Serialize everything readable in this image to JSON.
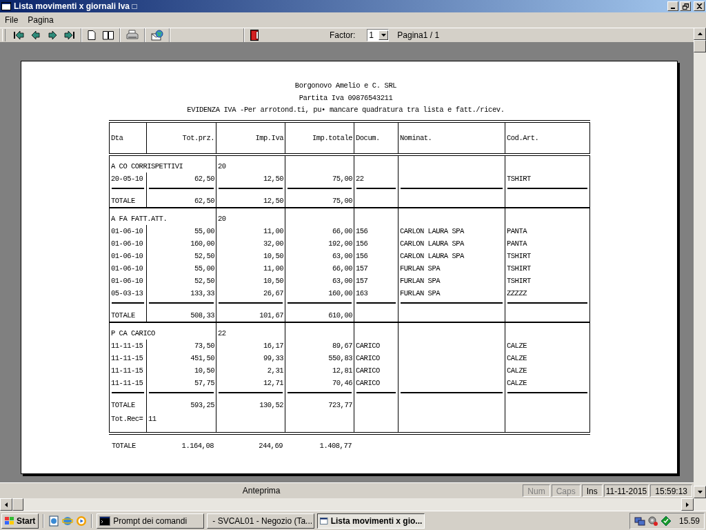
{
  "window": {
    "title": "Lista movimenti x giornali Iva □"
  },
  "menu": [
    "File",
    "Pagina"
  ],
  "toolbar": {
    "factor_label": "Factor:",
    "factor_value": "1",
    "page_label": "Pagina1 / 1"
  },
  "report": {
    "header_lines": [
      "Borgonovo Amelio e C. SRL",
      "Partita Iva  09876543211",
      "EVIDENZA IVA -Per arrotond.ti, pu• mancare quadratura tra lista e fatt./ricev."
    ],
    "columns": [
      {
        "label": "Dta",
        "kind": "text"
      },
      {
        "label": "Tot.prz.",
        "kind": "amount"
      },
      {
        "label": "Imp.Iva",
        "kind": "amount"
      },
      {
        "label": "Imp.totale",
        "kind": "amount"
      },
      {
        "label": "Docum.",
        "kind": "text"
      },
      {
        "label": "Nominat.",
        "kind": "text"
      },
      {
        "label": "Cod.Art.",
        "kind": "text"
      }
    ],
    "sections": [
      {
        "code": "A CO CORRISPETTIVI",
        "rate": "20",
        "rows": [
          [
            "20-05-10",
            "62,50",
            "12,50",
            "75,00",
            "22",
            "",
            "TSHIRT"
          ]
        ],
        "total": {
          "label": "TOTALE",
          "values": [
            "62,50",
            "12,50",
            "75,00"
          ]
        }
      },
      {
        "code": "A FA FATT.ATT.",
        "rate": "20",
        "rows": [
          [
            "01-06-10",
            "55,00",
            "11,00",
            "66,00",
            "156",
            "CARLON LAURA SPA",
            "PANTA"
          ],
          [
            "01-06-10",
            "160,00",
            "32,00",
            "192,00",
            "156",
            "CARLON LAURA SPA",
            "PANTA"
          ],
          [
            "01-06-10",
            "52,50",
            "10,50",
            "63,00",
            "156",
            "CARLON LAURA SPA",
            "TSHIRT"
          ],
          [
            "01-06-10",
            "55,00",
            "11,00",
            "66,00",
            "157",
            "FURLAN SPA",
            "TSHIRT"
          ],
          [
            "01-06-10",
            "52,50",
            "10,50",
            "63,00",
            "157",
            "FURLAN SPA",
            "TSHIRT"
          ],
          [
            "05-03-13",
            "133,33",
            "26,67",
            "160,00",
            "163",
            "FURLAN SPA",
            "ZZZZZ"
          ]
        ],
        "total": {
          "label": "TOTALE",
          "values": [
            "508,33",
            "101,67",
            "610,00"
          ]
        }
      },
      {
        "code": "P CA CARICO",
        "rate": "22",
        "rows": [
          [
            "11-11-15",
            "73,50",
            "16,17",
            "89,67",
            "CARICO",
            "",
            "CALZE"
          ],
          [
            "11-11-15",
            "451,50",
            "99,33",
            "550,83",
            "CARICO",
            "",
            "CALZE"
          ],
          [
            "11-11-15",
            "10,50",
            "2,31",
            "12,81",
            "CARICO",
            "",
            "CALZE"
          ],
          [
            "11-11-15",
            "57,75",
            "12,71",
            "70,46",
            "CARICO",
            "",
            "CALZE"
          ]
        ],
        "total": {
          "label": "TOTALE",
          "values": [
            "593,25",
            "130,52",
            "723,77"
          ]
        }
      }
    ],
    "record_count": {
      "label": "Tot.Rec=",
      "value": "11"
    },
    "grand_total": {
      "label": "TOTALE",
      "values": [
        "1.164,08",
        "244,69",
        "1.408,77"
      ]
    }
  },
  "status_bar": {
    "text": "Anteprima",
    "indicators": [
      {
        "label": "Num",
        "active": false
      },
      {
        "label": "Caps",
        "active": false
      },
      {
        "label": "Ins",
        "active": true
      }
    ],
    "date": "11-11-2015",
    "time": "15:59:13"
  },
  "taskbar": {
    "start": "Start",
    "tasks": [
      {
        "label": "Prompt dei comandi",
        "kind": "console",
        "selected": false
      },
      {
        "label": "- SVCAL01 - Negozio (Ta...",
        "kind": "window",
        "selected": false
      },
      {
        "label": "Lista movimenti x gio...",
        "kind": "window",
        "selected": true
      }
    ],
    "clock": "15.59"
  }
}
